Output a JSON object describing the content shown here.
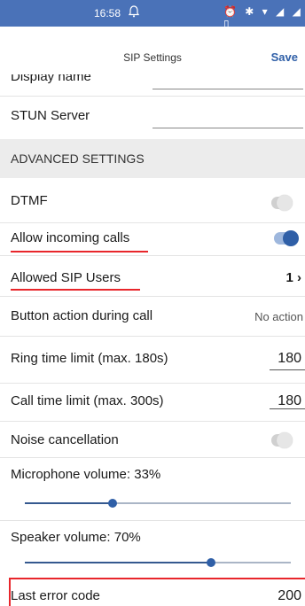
{
  "status_bar": {
    "time": "16:58",
    "left_icon": "alarm-icon",
    "right_icons": "⏰ ✱ ▾ ◢ ◢ ▯"
  },
  "nav": {
    "title": "SIP Settings",
    "save_label": "Save"
  },
  "rows": {
    "display_name_label": "Display name",
    "stun_server_label": "STUN Server",
    "advanced_header": "ADVANCED SETTINGS",
    "dtmf_label": "DTMF",
    "dtmf_on": false,
    "allow_incoming_label": "Allow incoming calls",
    "allow_incoming_on": true,
    "allowed_sip_users_label": "Allowed SIP Users",
    "allowed_sip_users_value": "1 ›",
    "button_action_label": "Button action during call",
    "button_action_value": "No action",
    "ring_time_label": "Ring time limit (max. 180s)",
    "ring_time_value": "180",
    "call_time_label": "Call time limit (max. 300s)",
    "call_time_value": "180",
    "noise_cancel_label": "Noise cancellation",
    "noise_cancel_on": false,
    "mic_volume_label": "Microphone volume: 33%",
    "mic_volume_level": 0.33,
    "speaker_volume_label": "Speaker volume: 70%",
    "speaker_volume_level": 0.7,
    "last_error_label": "Last error code",
    "last_error_value": "200"
  },
  "colors": {
    "accent": "#2f5fa7",
    "status_bar": "#4a72b8",
    "highlight_red": "#e8262b"
  }
}
